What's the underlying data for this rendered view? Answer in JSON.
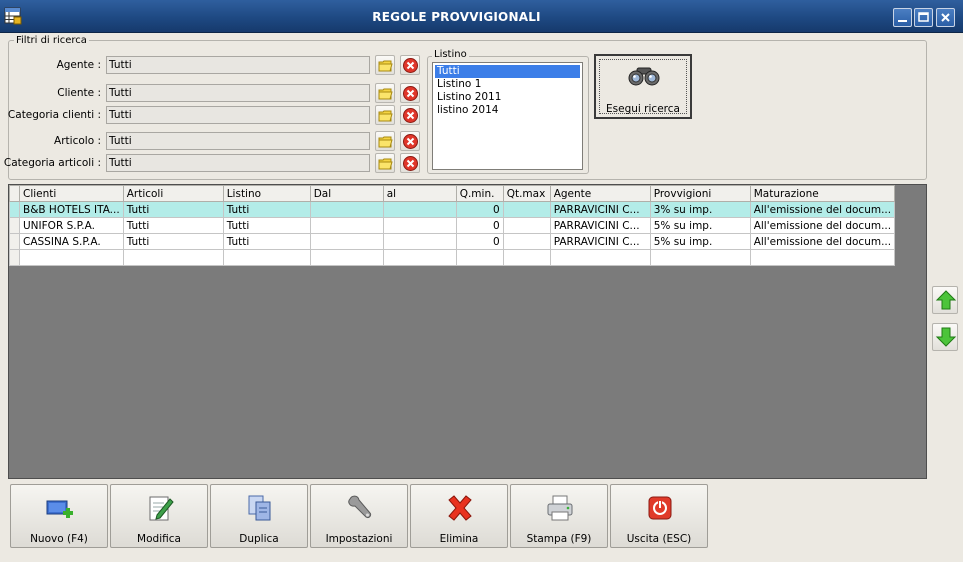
{
  "window": {
    "title": "REGOLE PROVVIGIONALI"
  },
  "filters": {
    "group_title": "Filtri di ricerca",
    "fields": [
      {
        "label": "Agente :",
        "value": "Tutti"
      },
      {
        "label": "Cliente :",
        "value": "Tutti"
      },
      {
        "label": "Categoria clienti :",
        "value": "Tutti"
      },
      {
        "label": "Articolo :",
        "value": "Tutti"
      },
      {
        "label": "Categoria articoli :",
        "value": "Tutti"
      }
    ],
    "listino": {
      "title": "Listino",
      "items": [
        "Tutti",
        "Listino 1",
        "Listino 2011",
        "listino 2014"
      ],
      "selected": "Tutti"
    },
    "search_button": {
      "label": "Esegui ricerca",
      "icon": "binoculars-icon"
    }
  },
  "grid": {
    "columns": [
      "Clienti",
      "Articoli",
      "Listino",
      "Dal",
      "al",
      "Q.min.",
      "Qt.max",
      "Agente",
      "Provvigioni",
      "Maturazione"
    ],
    "rows": [
      [
        "B&B HOTELS ITA...",
        "Tutti",
        "Tutti",
        "",
        "",
        "0",
        "",
        "PARRAVICINI C...",
        "3% su imp.",
        "All'emissione del docum..."
      ],
      [
        "UNIFOR S.P.A.",
        "Tutti",
        "Tutti",
        "",
        "",
        "0",
        "",
        "PARRAVICINI C...",
        "5% su imp.",
        "All'emissione del docum..."
      ],
      [
        "CASSINA S.P.A.",
        "Tutti",
        "Tutti",
        "",
        "",
        "0",
        "",
        "PARRAVICINI C...",
        "5% su imp.",
        "All'emissione del docum..."
      ]
    ],
    "selected_row": 0
  },
  "side_buttons": {
    "up_icon": "arrow-up-icon",
    "down_icon": "arrow-down-icon"
  },
  "toolbar": [
    {
      "label": "Nuovo (F4)",
      "icon": "new-icon"
    },
    {
      "label": "Modifica",
      "icon": "edit-icon"
    },
    {
      "label": "Duplica",
      "icon": "duplicate-icon"
    },
    {
      "label": "Impostazioni",
      "icon": "wrench-icon"
    },
    {
      "label": "Elimina",
      "icon": "delete-icon"
    },
    {
      "label": "Stampa (F9)",
      "icon": "printer-icon"
    },
    {
      "label": "Uscita (ESC)",
      "icon": "exit-icon"
    }
  ],
  "colors": {
    "titlebar": "#1d4780",
    "selected_row": "#b3ece8",
    "list_selection": "#3c7ee8",
    "grid_background": "#7b7b7b"
  }
}
